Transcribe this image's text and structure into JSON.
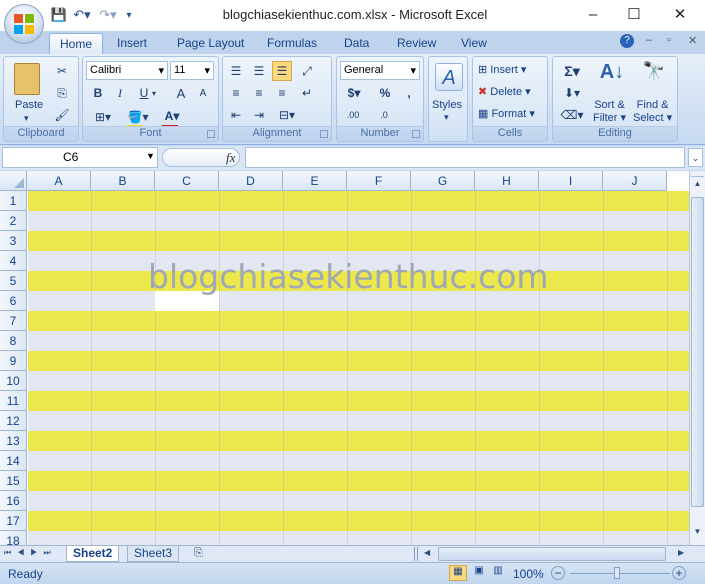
{
  "title": "blogchiasekienthuc.com.xlsx - Microsoft Excel",
  "window_controls": {
    "minimize": "–",
    "maximize": "☐",
    "close": "✕"
  },
  "tabs": [
    "Home",
    "Insert",
    "Page Layout",
    "Formulas",
    "Data",
    "Review",
    "View"
  ],
  "active_tab": "Home",
  "clipboard": {
    "paste": "Paste",
    "group": "Clipboard"
  },
  "font": {
    "name": "Calibri",
    "size": "11",
    "bold": "B",
    "italic": "I",
    "underline": "U",
    "grow": "A",
    "shrink": "A",
    "fontcolor": "A",
    "group": "Font",
    "accent": "#d11c1c",
    "highlight": "#f5e50a"
  },
  "alignment": {
    "group": "Alignment"
  },
  "number": {
    "format": "General",
    "currency": "$",
    "percent": "%",
    "comma": ",",
    "inc_dec": ".00",
    "group": "Number"
  },
  "styles": {
    "label": "Styles"
  },
  "cells": {
    "insert": "Insert",
    "delete": "Delete",
    "format": "Format",
    "group": "Cells"
  },
  "editing": {
    "sum": "Σ",
    "sort_line1": "Sort &",
    "sort_line2": "Filter",
    "find_line1": "Find &",
    "find_line2": "Select",
    "group": "Editing"
  },
  "formula_bar": {
    "name_box": "C6",
    "fx": "fx",
    "value": ""
  },
  "columns": [
    "A",
    "B",
    "C",
    "D",
    "E",
    "F",
    "G",
    "H",
    "I",
    "J"
  ],
  "rows": [
    "1",
    "2",
    "3",
    "4",
    "5",
    "6",
    "7",
    "8",
    "9",
    "10",
    "11",
    "12",
    "13",
    "14",
    "15",
    "16",
    "17",
    "18"
  ],
  "band_colors": {
    "yellow": "#ece84b",
    "gray": "#e3e7f1"
  },
  "selected_cell": "C6",
  "watermark": "blogchiasekienthuc.com",
  "sheets": [
    "Sheet2",
    "Sheet3"
  ],
  "active_sheet": "Sheet2",
  "status": {
    "ready": "Ready",
    "zoom": "100%"
  }
}
